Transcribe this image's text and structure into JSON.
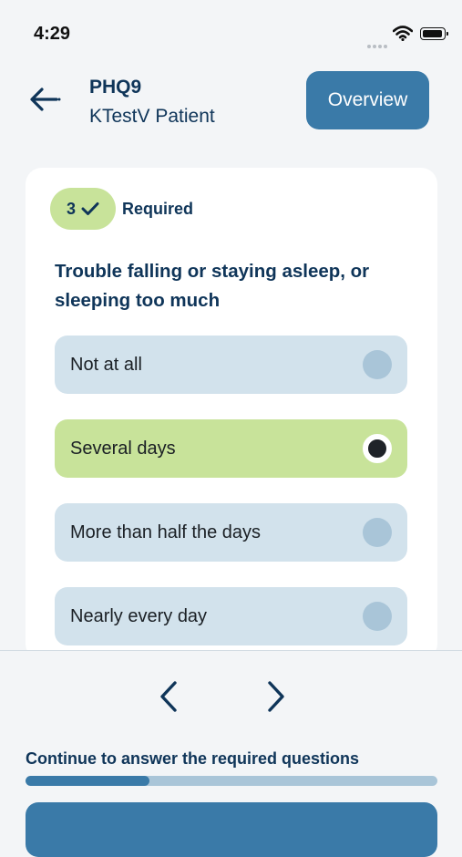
{
  "status_bar": {
    "time": "4:29"
  },
  "header": {
    "title": "PHQ9",
    "subtitle": "KTestV Patient",
    "overview_label": "Overview"
  },
  "question": {
    "number": "3",
    "required_label": "Required",
    "text": "Trouble falling or staying asleep, or sleeping too much",
    "options": [
      {
        "label": "Not at all",
        "selected": false
      },
      {
        "label": "Several days",
        "selected": true
      },
      {
        "label": "More than half the days",
        "selected": false
      },
      {
        "label": "Nearly every day",
        "selected": false
      }
    ]
  },
  "footer": {
    "progress_text": "Continue to answer the required questions",
    "progress_fraction": 0.3
  },
  "colors": {
    "accent": "#3a7aa8",
    "selected": "#c8e39a",
    "option": "#d2e2ec",
    "text": "#0f3559"
  },
  "icons": [
    "back-arrow-icon",
    "checkmark-icon",
    "chevron-left-icon",
    "chevron-right-icon",
    "wifi-icon",
    "battery-icon"
  ]
}
